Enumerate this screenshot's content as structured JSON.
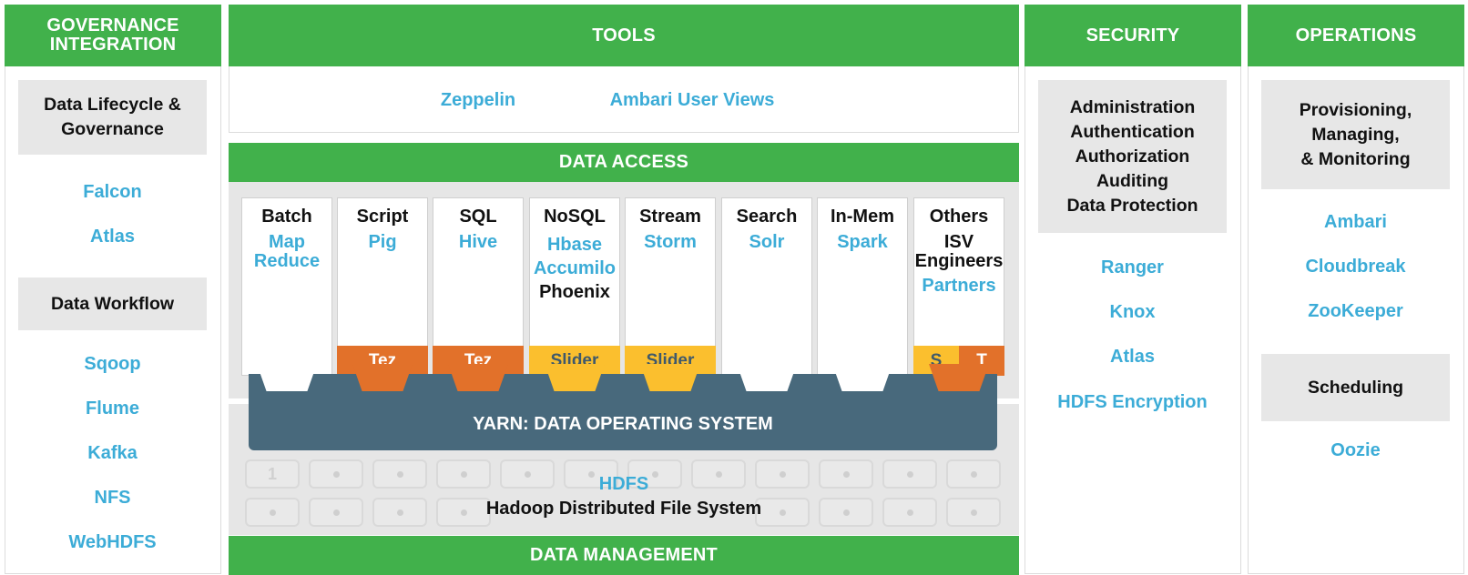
{
  "governance": {
    "header": "GOVERNANCE INTEGRATION",
    "box1": "Data Lifecycle & Governance",
    "items1": [
      "Falcon",
      "Atlas"
    ],
    "box2": "Data Workflow",
    "items2": [
      "Sqoop",
      "Flume",
      "Kafka",
      "NFS",
      "WebHDFS"
    ]
  },
  "tools": {
    "header": "TOOLS",
    "items": [
      "Zeppelin",
      "Ambari User Views"
    ]
  },
  "data_access": {
    "header": "DATA ACCESS",
    "columns": [
      {
        "title": "Batch",
        "items": [
          "Map",
          "Reduce"
        ]
      },
      {
        "title": "Script",
        "items": [
          "Pig"
        ]
      },
      {
        "title": "SQL",
        "items": [
          "Hive"
        ]
      },
      {
        "title": "NoSQL",
        "items": [
          "Hbase",
          "Accumilo"
        ],
        "dark_items": [
          "Phoenix"
        ]
      },
      {
        "title": "Stream",
        "items": [
          "Storm"
        ]
      },
      {
        "title": "Search",
        "items": [
          "Solr"
        ]
      },
      {
        "title": "In-Mem",
        "items": [
          "Spark"
        ]
      },
      {
        "title": "Others",
        "dark_items": [
          "ISV",
          "Engineers"
        ],
        "items": [
          "Partners"
        ]
      }
    ],
    "engines": {
      "tez1": "Tez",
      "tez2": "Tez",
      "slider1": "Slider",
      "slider2": "Slider",
      "s": "S",
      "t": "T"
    },
    "yarn": "YARN: DATA OPERATING SYSTEM",
    "hdfs_title": "HDFS",
    "hdfs_subtitle": "Hadoop Distributed File System",
    "disk_label": "1"
  },
  "data_management": {
    "header": "DATA MANAGEMENT"
  },
  "security": {
    "header": "SECURITY",
    "box": [
      "Administration",
      "Authentication",
      "Authorization",
      "Auditing",
      "Data Protection"
    ],
    "items": [
      "Ranger",
      "Knox",
      "Atlas",
      "HDFS Encryption"
    ]
  },
  "operations": {
    "header": "OPERATIONS",
    "box1": [
      "Provisioning,",
      "Managing,",
      "& Monitoring"
    ],
    "items1": [
      "Ambari",
      "Cloudbreak",
      "ZooKeeper"
    ],
    "box2": "Scheduling",
    "items2": [
      "Oozie"
    ]
  },
  "colors": {
    "green": "#41b14b",
    "blue": "#3cacd7",
    "yarn": "#48697c",
    "orange": "#e2712a",
    "yellow": "#fbbf2e"
  }
}
